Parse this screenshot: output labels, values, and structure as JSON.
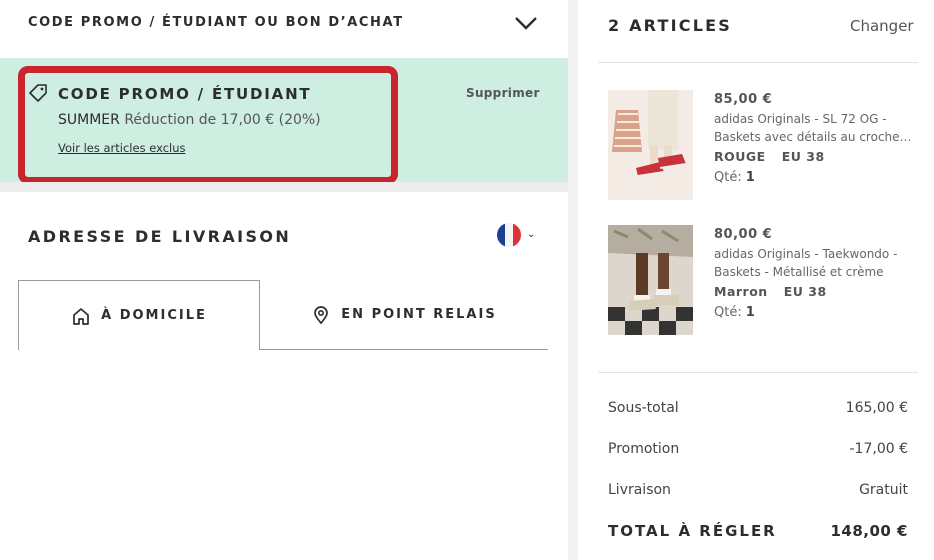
{
  "promo_section": {
    "header_title": "CODE PROMO / ÉTUDIANT OU BON D’ACHAT",
    "applied_title": "CODE PROMO / ÉTUDIANT",
    "code": "SUMMER",
    "discount_text": "Réduction de 17,00 € (20%)",
    "excluded_link": "Voir les articles exclus",
    "remove_label": "Supprimer",
    "highlight_color": "#c9252c",
    "background_color": "#cdeee0"
  },
  "delivery": {
    "title": "ADRESSE DE LIVRAISON",
    "country_flag": "france-flag-icon",
    "tabs": [
      {
        "label": "À DOMICILE",
        "icon": "home-icon",
        "selected": true
      },
      {
        "label": "EN POINT RELAIS",
        "icon": "location-pin-icon",
        "selected": false
      }
    ]
  },
  "cart": {
    "title": "2 ARTICLES",
    "change_label": "Changer",
    "items": [
      {
        "price": "85,00 €",
        "desc_line1": "adidas Originals - SL 72 OG -",
        "desc_line2": "Baskets avec détails au crochet...",
        "color": "ROUGE",
        "size": "EU 38",
        "qty_label": "Qté:",
        "qty": "1"
      },
      {
        "price": "80,00 €",
        "desc_line1": "adidas Originals - Taekwondo -",
        "desc_line2": "Baskets - Métallisé et crème",
        "color": "Marron",
        "size": "EU 38",
        "qty_label": "Qté:",
        "qty": "1"
      }
    ]
  },
  "summary": {
    "subtotal_label": "Sous-total",
    "subtotal": "165,00 €",
    "promo_label": "Promotion",
    "promo": "-17,00 €",
    "shipping_label": "Livraison",
    "shipping": "Gratuit",
    "total_label": "TOTAL À RÉGLER",
    "total": "148,00 €"
  }
}
